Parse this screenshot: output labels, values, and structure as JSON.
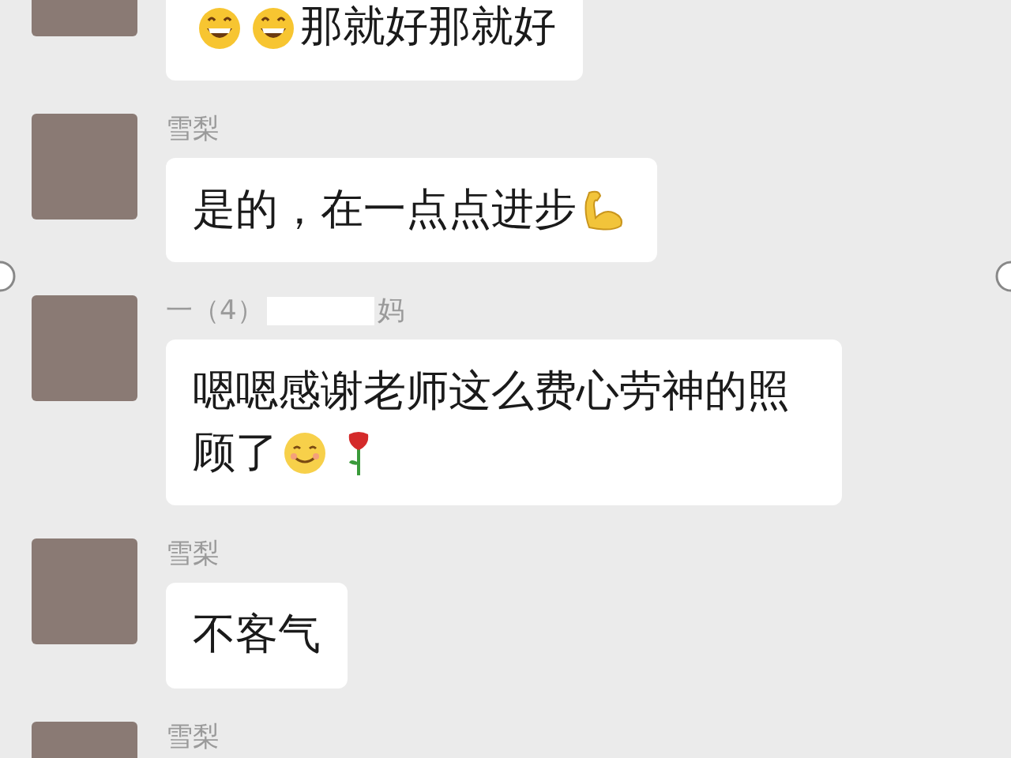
{
  "messages": [
    {
      "content": [
        {
          "kind": "grin"
        },
        {
          "kind": "grin"
        },
        {
          "kind": "text",
          "text": "那就好那就好"
        }
      ]
    },
    {
      "sender": [
        {
          "kind": "text",
          "text": "雪梨"
        }
      ],
      "content": [
        {
          "kind": "text",
          "text": "是的，在一点点进步"
        },
        {
          "kind": "muscle"
        }
      ]
    },
    {
      "sender": [
        {
          "kind": "text",
          "text": "一（4）"
        },
        {
          "kind": "redacted"
        },
        {
          "kind": "text",
          "text": "妈"
        }
      ],
      "content": [
        {
          "kind": "text",
          "text": "嗯嗯感谢老师这么费心劳神的照顾了"
        },
        {
          "kind": "smile"
        },
        {
          "kind": "rose"
        }
      ]
    },
    {
      "sender": [
        {
          "kind": "text",
          "text": "雪梨"
        }
      ],
      "content": [
        {
          "kind": "text",
          "text": "不客气"
        }
      ]
    },
    {
      "sender": [
        {
          "kind": "text",
          "text": "雪梨"
        }
      ]
    }
  ]
}
